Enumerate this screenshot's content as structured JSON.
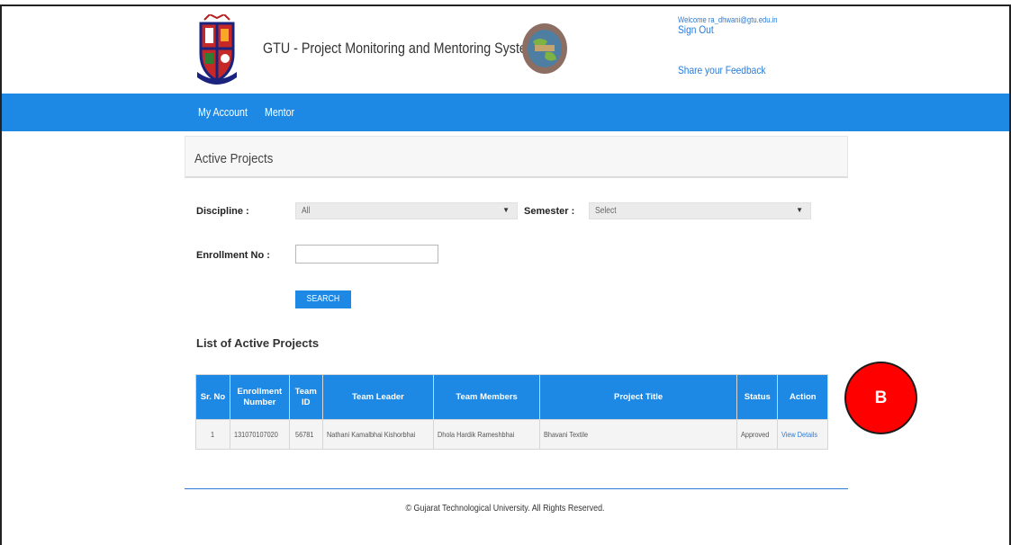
{
  "header": {
    "title": "GTU - Project Monitoring and Mentoring System",
    "welcome": "Welcome ra_dhwani@gtu.edu.in",
    "sign_out": "Sign Out",
    "feedback": "Share your Feedback"
  },
  "nav": {
    "items": [
      {
        "label": "My Account"
      },
      {
        "label": "Mentor"
      }
    ]
  },
  "panel": {
    "title": "Active Projects"
  },
  "filters": {
    "discipline_label": "Discipline :",
    "discipline_value": "All",
    "semester_label": "Semester :",
    "semester_value": "Select",
    "enrollment_label": "Enrollment No :",
    "enrollment_value": "",
    "search_label": "SEARCH"
  },
  "list": {
    "title": "List of Active Projects",
    "columns": [
      "Sr. No",
      "Enrollment Number",
      "Team ID",
      "Team Leader",
      "Team Members",
      "Project Title",
      "Status",
      "Action"
    ],
    "rows": [
      {
        "sr": "1",
        "enrollment": "131070107020",
        "team_id": "56781",
        "leader": "Nathani Kamalbhai Kishorbhai",
        "members": "Dhola Hardik Rameshbhai",
        "project": "Bhavani Textile",
        "status": "Approved",
        "action": "View Details"
      }
    ]
  },
  "annotation": {
    "label": "B"
  },
  "footer": {
    "text": "© Gujarat Technological University. All Rights Reserved."
  },
  "colors": {
    "primary": "#1e88e5",
    "link": "#2a7bd6",
    "annotation": "#ff0000"
  },
  "icons": {
    "dropdown": "caret-down-icon",
    "logo_left": "gtu-crest-logo",
    "logo_right": "globe-emblem-logo"
  }
}
